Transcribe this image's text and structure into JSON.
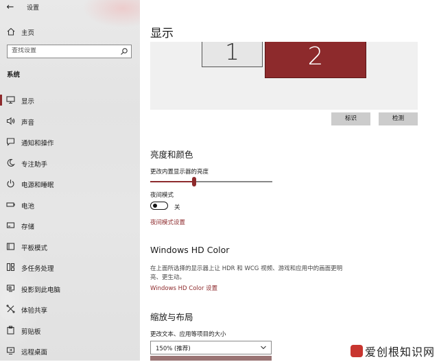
{
  "window": {
    "title": "设置"
  },
  "sidebar": {
    "home_label": "主页",
    "search_placeholder": "查找设置",
    "section_title": "系统",
    "items": [
      {
        "label": "显示",
        "icon": "monitor-icon",
        "active": true
      },
      {
        "label": "声音",
        "icon": "speaker-icon"
      },
      {
        "label": "通知和操作",
        "icon": "notification-icon"
      },
      {
        "label": "专注助手",
        "icon": "moon-icon"
      },
      {
        "label": "电源和睡眠",
        "icon": "power-icon"
      },
      {
        "label": "电池",
        "icon": "battery-icon"
      },
      {
        "label": "存储",
        "icon": "storage-icon"
      },
      {
        "label": "平板模式",
        "icon": "tablet-icon"
      },
      {
        "label": "多任务处理",
        "icon": "multitask-icon"
      },
      {
        "label": "投影到此电脑",
        "icon": "project-icon"
      },
      {
        "label": "体验共享",
        "icon": "share-icon"
      },
      {
        "label": "剪贴板",
        "icon": "clipboard-icon"
      },
      {
        "label": "远程桌面",
        "icon": "remote-desktop-icon"
      }
    ]
  },
  "main": {
    "title": "显示",
    "monitors": [
      {
        "label": "1"
      },
      {
        "label": "2",
        "selected": true
      }
    ],
    "identify_label": "标识",
    "detect_label": "检测",
    "brightness": {
      "heading": "亮度和颜色",
      "label": "更改内置显示器的亮度",
      "value": 0.36,
      "night_label": "夜间模式",
      "night_state": "关",
      "night_on": false,
      "night_link": "夜间模式设置"
    },
    "hdr": {
      "heading": "Windows HD Color",
      "description": "在上面所选择的显示器上让 HDR 和 WCG 视频、游戏和应用中的画面更明亮、更生动。",
      "link": "Windows HD Color 设置"
    },
    "scale": {
      "heading": "缩放与布局",
      "label": "更改文本、应用等项目的大小",
      "selected": "150% (推荐)"
    }
  },
  "watermark": {
    "text": "爱创根知识网"
  },
  "colors": {
    "accent": "#8d2a2c",
    "sidebar_bg": "#e6e6e6"
  }
}
